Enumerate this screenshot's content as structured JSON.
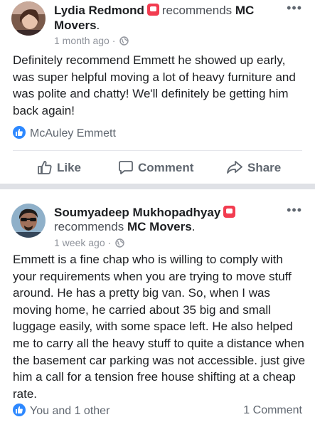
{
  "posts": [
    {
      "author": "Lydia Redmond",
      "recommends_word": "recommends",
      "page_line1": "MC",
      "page_line2": "Movers",
      "page_suffix": ".",
      "time": "1 month ago",
      "dot": "·",
      "text": "Definitely recommend Emmett he showed up early, was super helpful moving a lot of heavy furniture and was polite and chatty! We'll definitely be getting him back again!",
      "reactions": "McAuley Emmett"
    },
    {
      "author": "Soumyadeep Mukhopadhyay",
      "recommends_word": "recommends",
      "page": "MC Movers",
      "page_suffix": ".",
      "time": "1 week ago",
      "dot": "·",
      "text": "Emmett is a fine chap who is willing to comply with your requirements when you are trying to move stuff around. He has a pretty big van. So, when I was moving home, he carried about 35 big and small luggage easily, with some space left. He also helped me to carry all the heavy stuff to quite a distance when the basement car parking was not accessible. just give him a call for a tension free house shifting at a cheap rate.",
      "reactions": "You and 1 other",
      "comments": "1 Comment"
    }
  ],
  "actions": {
    "like": "Like",
    "comment": "Comment",
    "share": "Share"
  },
  "more_glyph": "•••",
  "colors": {
    "accent": "#2d88ff",
    "badge": "#f23c50",
    "separator": "#dfe1e6"
  },
  "icons": [
    "recommendation-badge-icon",
    "globe-icon",
    "like-thumb-icon",
    "comment-bubble-icon",
    "share-arrow-icon",
    "more-options-icon"
  ]
}
